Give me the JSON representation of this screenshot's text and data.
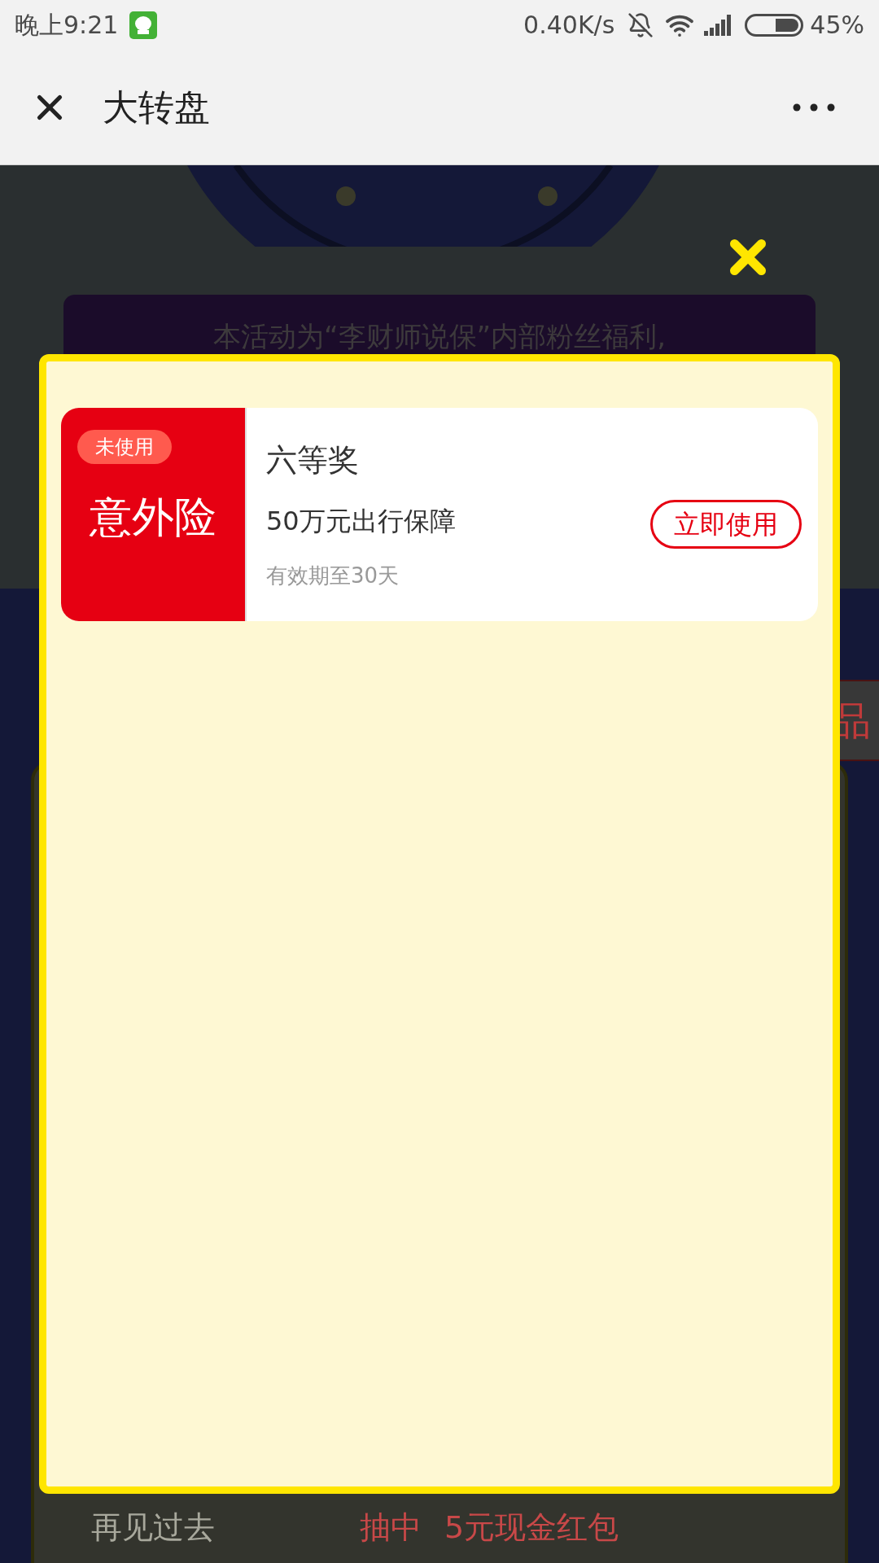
{
  "status_bar": {
    "time": "晚上9:21",
    "network_speed": "0.40K/s",
    "battery": "45%"
  },
  "header": {
    "title": "大转盘"
  },
  "background": {
    "notice": "本活动为“李财师说保”内部粉丝福利,",
    "side_tab": "品",
    "record": {
      "user": "再见过去",
      "action": "抽中",
      "prize": "5元现金红包"
    }
  },
  "modal": {
    "coupons": [
      {
        "type_label": "意外险",
        "status": "未使用",
        "tier": "六等奖",
        "description": "50万元出行保障",
        "validity": "有效期至30天",
        "action": "立即使用"
      }
    ]
  }
}
